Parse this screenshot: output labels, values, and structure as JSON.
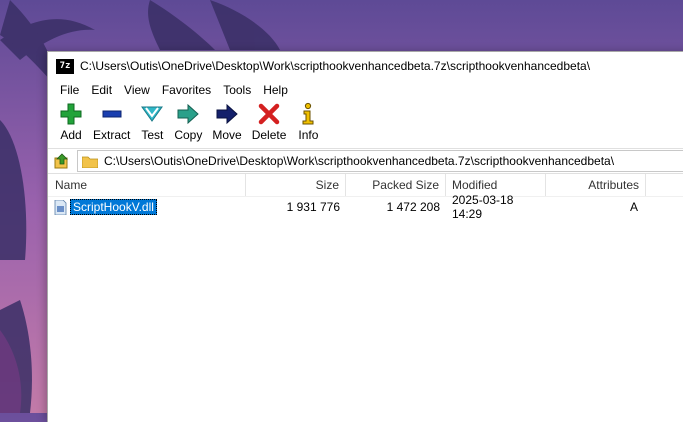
{
  "window": {
    "title": "C:\\Users\\Outis\\OneDrive\\Desktop\\Work\\scripthookvenhancedbeta.7z\\scripthookvenhancedbeta\\",
    "logo_text": "7z"
  },
  "menu": {
    "file": "File",
    "edit": "Edit",
    "view": "View",
    "favorites": "Favorites",
    "tools": "Tools",
    "help": "Help"
  },
  "toolbar": {
    "add": "Add",
    "extract": "Extract",
    "test": "Test",
    "copy": "Copy",
    "move": "Move",
    "delete": "Delete",
    "info": "Info"
  },
  "address": {
    "path": "C:\\Users\\Outis\\OneDrive\\Desktop\\Work\\scripthookvenhancedbeta.7z\\scripthookvenhancedbeta\\"
  },
  "list": {
    "columns": {
      "name": "Name",
      "size": "Size",
      "packed_size": "Packed Size",
      "modified": "Modified",
      "attributes": "Attributes"
    },
    "rows": [
      {
        "name": "ScriptHookV.dll",
        "size": "1 931 776",
        "packed_size": "1 472 208",
        "modified": "2025-03-18 14:29",
        "attributes": "A",
        "selected": true
      }
    ]
  },
  "colors": {
    "selection": "#0078d7",
    "add_green": "#22a33a",
    "extract_blue": "#1a3fb0",
    "test_cyan": "#30b8c8",
    "delete_red": "#d42020",
    "info_yellow": "#f0c000"
  }
}
